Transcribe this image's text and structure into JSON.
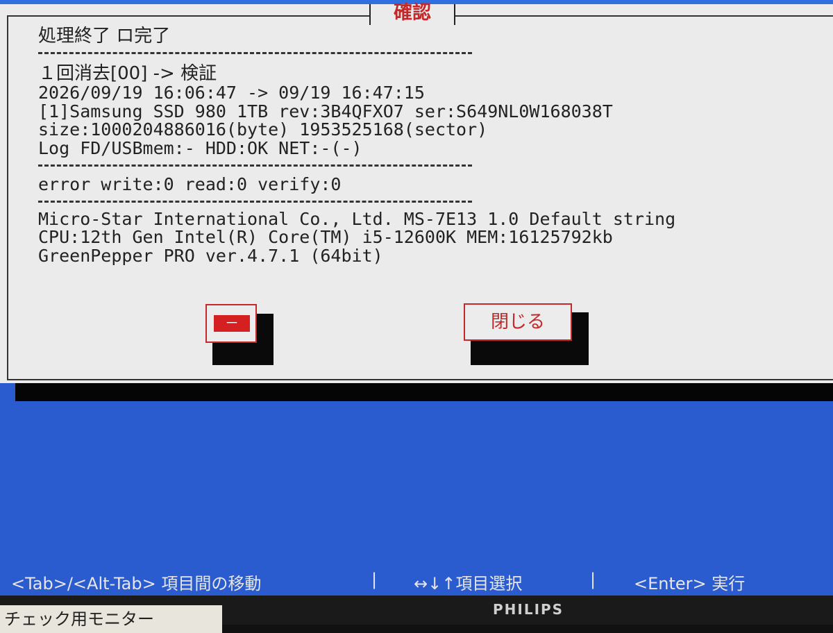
{
  "dialog": {
    "title": "確認",
    "heading": "処理終了 ロ完了",
    "pass_line": "１回消去[00] -> 検証",
    "time_line": "2026/09/19 16:06:47 -> 09/19 16:47:15",
    "drive_line": "[1]Samsung SSD 980 1TB rev:3B4QFXO7 ser:S649NL0W168038T",
    "size_line": "size:1000204886016(byte) 1953525168(sector)",
    "log_line": "Log FD/USBmem:- HDD:OK NET:-(-)",
    "error_line": "error write:0 read:0 verify:0",
    "board_line": "Micro-Star International Co., Ltd. MS-7E13 1.0 Default string",
    "cpu_line": "CPU:12th Gen Intel(R) Core(TM) i5-12600K MEM:16125792kb",
    "version_line": "GreenPepper PRO ver.4.7.1 (64bit)",
    "button_dash_label": "－",
    "button_close_label": "閉じる"
  },
  "statusbar": {
    "tab_hint": "<Tab>/<Alt-Tab> 項目間の移動",
    "sep1": "|",
    "arrow_hint": "↔↓↑項目選択",
    "sep2": "|",
    "enter_hint": "<Enter> 実行"
  },
  "monitor": {
    "brand": "PHILIPS",
    "sticker_text": "チェック用モニター"
  },
  "colors": {
    "background_blue": "#2a5cd0",
    "dialog_bg": "#ebebeb",
    "accent_red": "#c42828",
    "text_dark": "#222222"
  }
}
